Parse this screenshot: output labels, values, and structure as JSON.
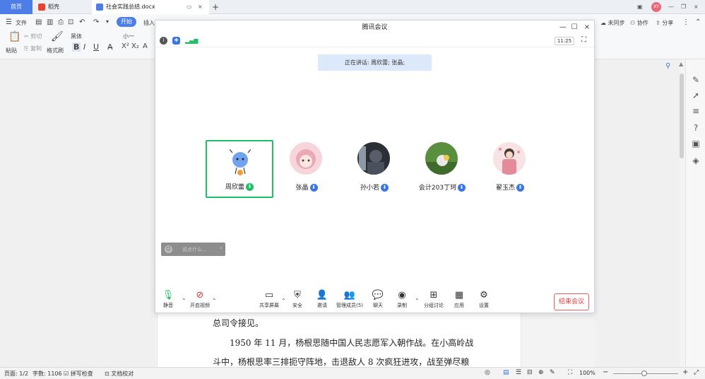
{
  "tabs": {
    "home": "首页",
    "draft": "稻壳",
    "doc": "社会实践总结.docx",
    "new_tab": "+"
  },
  "toolbar": {
    "file": "文件",
    "start": "开始",
    "insert": "插入",
    "paste": "粘贴",
    "cut": "剪切",
    "copy": "复制",
    "format_painter": "格式刷",
    "font": "黑体",
    "size": "小一",
    "bold": "B",
    "italic": "I",
    "underline": "U",
    "unsync": "未同步",
    "collab": "协作",
    "share": "分享",
    "avatar": "XY"
  },
  "meeting": {
    "title": "腾讯会议",
    "time": "11:25",
    "speaking": "正在讲话: 周欣蕾; 张晶;",
    "participants": [
      {
        "name": "周欣蕾",
        "active": true
      },
      {
        "name": "张晶",
        "active": false
      },
      {
        "name": "孙小若",
        "active": false
      },
      {
        "name": "会计203丁珂",
        "active": false
      },
      {
        "name": "翟玉杰",
        "active": false
      }
    ],
    "chat_placeholder": "说点什么...",
    "controls": {
      "mute": "静音",
      "video": "开启视频",
      "share_screen": "共享屏幕",
      "security": "安全",
      "invite": "邀请",
      "manage": "管理成员(5)",
      "chat": "聊天",
      "record": "录制",
      "breakout": "分组讨论",
      "apps": "应用",
      "settings": "设置"
    },
    "end": "结束会议"
  },
  "document": {
    "line1": "总司令接见。",
    "line2": "1950 年 11 月，杨根思随中国人民志愿军入朝作战。在小高岭战",
    "line3": "斗中，杨根思率三排扼守阵地，击退敌人 8 次疯狂进攻，战至弹尽粮"
  },
  "status": {
    "page": "页面: 1/2",
    "words": "字数: 1106",
    "spell": "拼写检查",
    "proof": "文档校对",
    "zoom": "100%"
  }
}
